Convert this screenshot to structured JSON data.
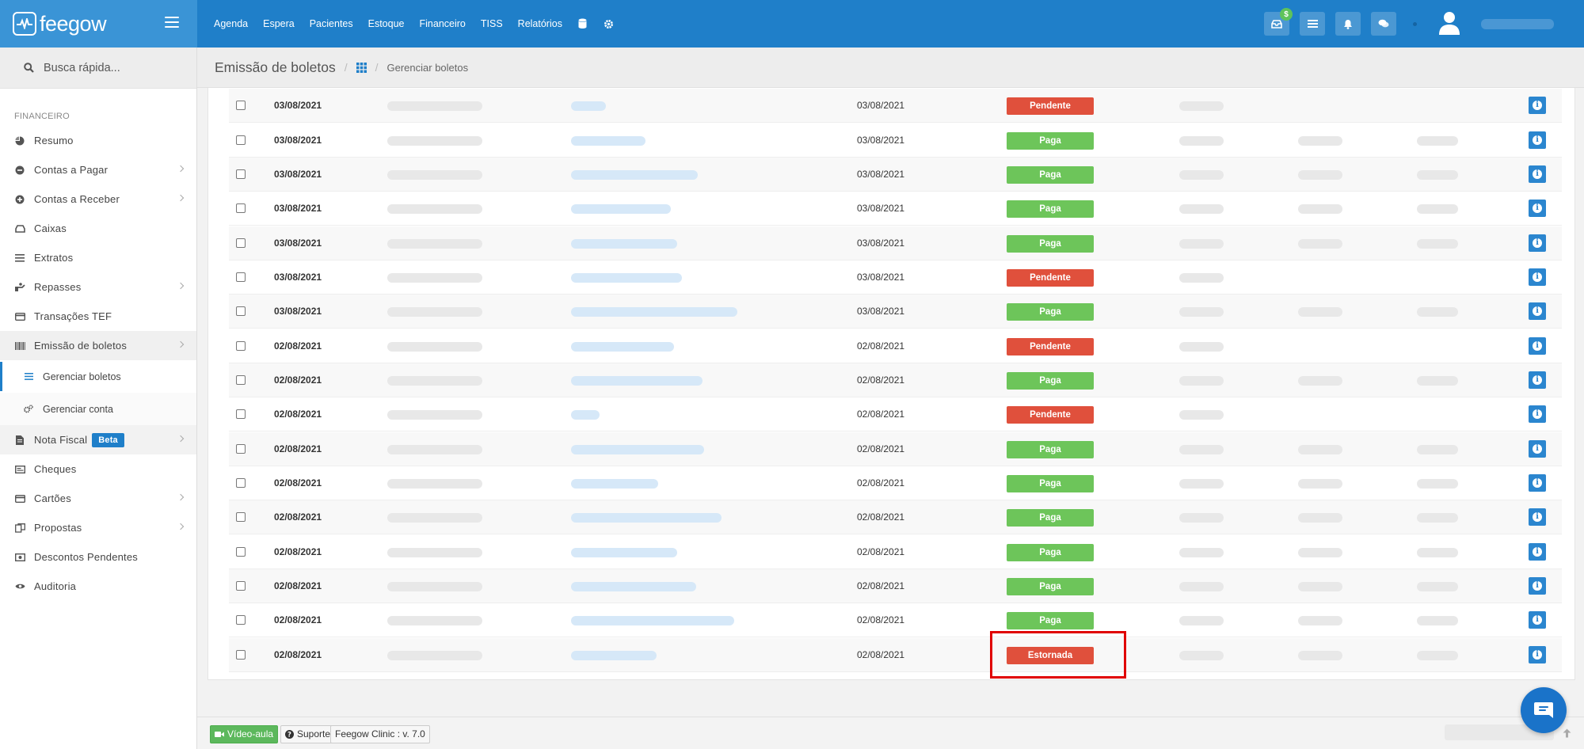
{
  "brand": {
    "name": "feegow"
  },
  "topnav": [
    "Agenda",
    "Espera",
    "Pacientes",
    "Estoque",
    "Financeiro",
    "TISS",
    "Relatórios"
  ],
  "topbar": {
    "badge": "$"
  },
  "search": {
    "label": "Busca rápida..."
  },
  "sidebar": {
    "section": "FINANCEIRO",
    "items": [
      {
        "label": "Resumo"
      },
      {
        "label": "Contas a Pagar"
      },
      {
        "label": "Contas a Receber"
      },
      {
        "label": "Caixas"
      },
      {
        "label": "Extratos"
      },
      {
        "label": "Repasses"
      },
      {
        "label": "Transações TEF"
      },
      {
        "label": "Emissão de boletos"
      },
      {
        "label": "Gerenciar boletos"
      },
      {
        "label": "Gerenciar conta"
      },
      {
        "label": "Nota Fiscal",
        "badge": "Beta"
      },
      {
        "label": "Cheques"
      },
      {
        "label": "Cartões"
      },
      {
        "label": "Propostas"
      },
      {
        "label": "Descontos Pendentes"
      },
      {
        "label": "Auditoria"
      }
    ]
  },
  "breadcrumb": {
    "title": "Emissão de boletos",
    "current": "Gerenciar boletos"
  },
  "rows": [
    {
      "date": "03/08/2021",
      "due": "03/08/2021",
      "status": "Pendente"
    },
    {
      "date": "03/08/2021",
      "due": "03/08/2021",
      "status": "Paga"
    },
    {
      "date": "03/08/2021",
      "due": "03/08/2021",
      "status": "Paga"
    },
    {
      "date": "03/08/2021",
      "due": "03/08/2021",
      "status": "Paga"
    },
    {
      "date": "03/08/2021",
      "due": "03/08/2021",
      "status": "Paga"
    },
    {
      "date": "03/08/2021",
      "due": "03/08/2021",
      "status": "Pendente"
    },
    {
      "date": "03/08/2021",
      "due": "03/08/2021",
      "status": "Paga"
    },
    {
      "date": "02/08/2021",
      "due": "02/08/2021",
      "status": "Pendente"
    },
    {
      "date": "02/08/2021",
      "due": "02/08/2021",
      "status": "Paga"
    },
    {
      "date": "02/08/2021",
      "due": "02/08/2021",
      "status": "Pendente"
    },
    {
      "date": "02/08/2021",
      "due": "02/08/2021",
      "status": "Paga"
    },
    {
      "date": "02/08/2021",
      "due": "02/08/2021",
      "status": "Paga"
    },
    {
      "date": "02/08/2021",
      "due": "02/08/2021",
      "status": "Paga"
    },
    {
      "date": "02/08/2021",
      "due": "02/08/2021",
      "status": "Paga"
    },
    {
      "date": "02/08/2021",
      "due": "02/08/2021",
      "status": "Paga"
    },
    {
      "date": "02/08/2021",
      "due": "02/08/2021",
      "status": "Paga"
    },
    {
      "date": "02/08/2021",
      "due": "02/08/2021",
      "status": "Estornada"
    }
  ],
  "footer": {
    "video": "Vídeo-aula",
    "support": "Suporte",
    "version": "Feegow Clinic : v. 7.0"
  },
  "colors": {
    "primary": "#1f7fc9",
    "paid": "#6dc55a",
    "pending": "#e0503c",
    "highlight": "#e00000"
  }
}
